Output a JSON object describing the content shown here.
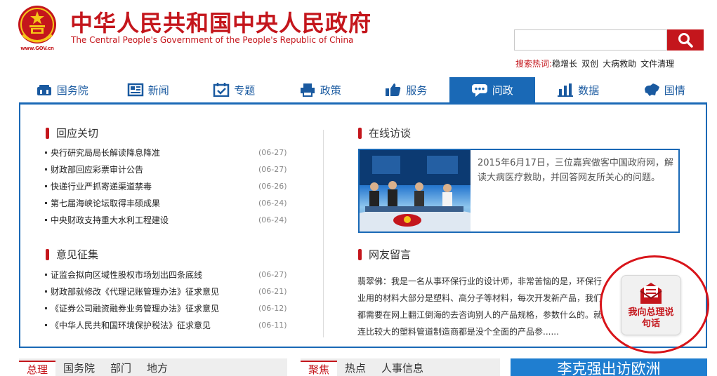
{
  "header": {
    "title_cn": "中华人民共和国中央人民政府",
    "title_en": "The Central People's Government of the People's Republic of China",
    "emblem_url_text": "www.GOV.cn"
  },
  "search": {
    "value": "",
    "placeholder": "",
    "hot_label": "搜索热词:",
    "hot_words": [
      "稳增长",
      "双创",
      "大病救助",
      "文件清理"
    ]
  },
  "nav": {
    "items": [
      {
        "label": "国务院",
        "icon": "building-icon"
      },
      {
        "label": "新闻",
        "icon": "newspaper-icon"
      },
      {
        "label": "专题",
        "icon": "calendar-check-icon"
      },
      {
        "label": "政策",
        "icon": "printer-icon"
      },
      {
        "label": "服务",
        "icon": "thumbs-up-icon"
      },
      {
        "label": "问政",
        "icon": "chat-bubble-icon"
      },
      {
        "label": "数据",
        "icon": "bar-chart-icon"
      },
      {
        "label": "国情",
        "icon": "china-map-icon"
      }
    ],
    "active_index": 5
  },
  "response": {
    "title": "回应关切",
    "items": [
      {
        "title": "央行研究局局长解读降息降准",
        "date": "(06-27)"
      },
      {
        "title": "财政部回应彩票审计公告",
        "date": "(06-27)"
      },
      {
        "title": "快递行业严抓寄递渠道禁毒",
        "date": "(06-26)"
      },
      {
        "title": "第七届海峡论坛取得丰硕成果",
        "date": "(06-24)"
      },
      {
        "title": "中央财政支持重大水利工程建设",
        "date": "(06-24)"
      }
    ]
  },
  "opinion": {
    "title": "意见征集",
    "items": [
      {
        "title": "证监会拟向区域性股权市场划出四条底线",
        "date": "(06-27)"
      },
      {
        "title": "财政部就修改《代理记账管理办法》征求意见",
        "date": "(06-21)"
      },
      {
        "title": "《证券公司融资融券业务管理办法》征求意见",
        "date": "(06-12)"
      },
      {
        "title": "《中华人民共和国环境保护税法》征求意见",
        "date": "(06-11)"
      }
    ]
  },
  "interview": {
    "title": "在线访谈",
    "text": "2015年6月17日，三位嘉宾做客中国政府网，解读大病医疗救助，并回答网友所关心的问题。"
  },
  "messages": {
    "title": "网友留言",
    "text": "翡翠佛：我是一名从事环保行业的设计师，非常苦恼的是，环保行业用的材料大部分是塑料、高分子等材料，每次开发新产品，我们都需要在网上翻江倒海的去咨询别人的产品规格，参数什么的。就连比较大的塑料管道制造商都是没个全面的产品参......"
  },
  "premier_button": {
    "label": "我向总理说句话"
  },
  "bottom": {
    "tabs_a": [
      "总理",
      "国务院",
      "部门",
      "地方"
    ],
    "tabs_b": [
      "聚焦",
      "热点",
      "人事信息"
    ],
    "banner": "李克强出访欧洲"
  },
  "colors": {
    "brand_red": "#c4161c",
    "nav_blue": "#1a69b6",
    "annotation_red": "#d8141a"
  }
}
